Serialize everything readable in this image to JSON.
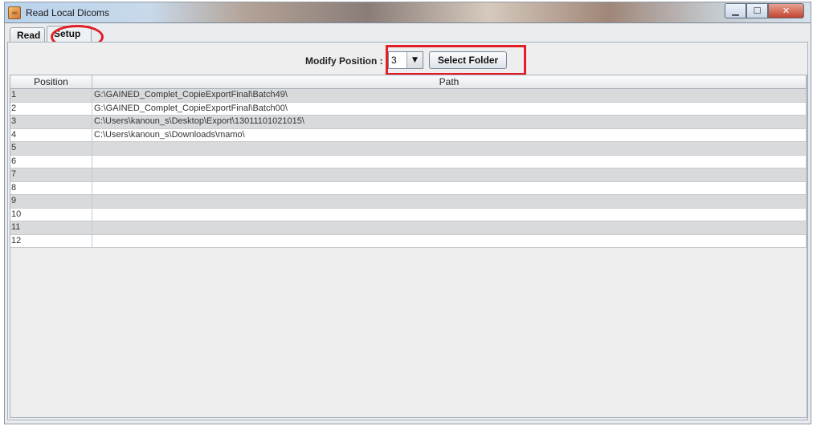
{
  "window": {
    "title": "Read Local Dicoms",
    "icon": "java-cup-icon",
    "controls": [
      "minimize",
      "maximize",
      "close"
    ]
  },
  "tabs": [
    {
      "label": "Read",
      "selected": false
    },
    {
      "label": "Setup",
      "selected": true
    }
  ],
  "toolbar": {
    "modify_label": "Modify Position :",
    "position_value": "3",
    "select_folder_label": "Select Folder"
  },
  "table": {
    "columns": [
      "Position",
      "Path"
    ],
    "rows": [
      {
        "position": "1",
        "path": "G:\\GAINED_Complet_CopieExportFinal\\Batch49\\"
      },
      {
        "position": "2",
        "path": "G:\\GAINED_Complet_CopieExportFinal\\Batch00\\"
      },
      {
        "position": "3",
        "path": "C:\\Users\\kanoun_s\\Desktop\\Export\\13011101021015\\"
      },
      {
        "position": "4",
        "path": "C:\\Users\\kanoun_s\\Downloads\\mamo\\"
      },
      {
        "position": "5",
        "path": ""
      },
      {
        "position": "6",
        "path": ""
      },
      {
        "position": "7",
        "path": ""
      },
      {
        "position": "8",
        "path": ""
      },
      {
        "position": "9",
        "path": ""
      },
      {
        "position": "10",
        "path": ""
      },
      {
        "position": "11",
        "path": ""
      },
      {
        "position": "12",
        "path": ""
      }
    ]
  },
  "colors": {
    "highlight": "#e11f26",
    "row_alt": "#d9dadc"
  }
}
